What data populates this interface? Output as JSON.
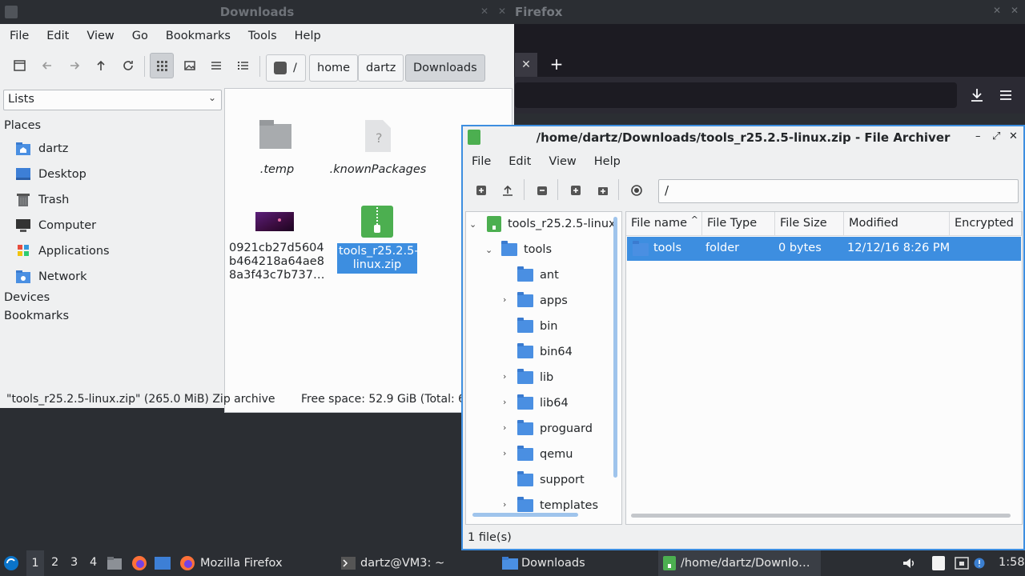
{
  "firefox": {
    "title": "Firefox",
    "close_tab": "✕",
    "new_tab": "+"
  },
  "file_manager": {
    "title": "Downloads",
    "menu": [
      "File",
      "Edit",
      "View",
      "Go",
      "Bookmarks",
      "Tools",
      "Help"
    ],
    "breadcrumbs": {
      "root": "/",
      "home": "home",
      "user": "dartz",
      "current": "Downloads"
    },
    "sidebar": {
      "dropdown": "Lists",
      "places_header": "Places",
      "places": [
        "dartz",
        "Desktop",
        "Trash",
        "Computer",
        "Applications",
        "Network"
      ],
      "devices_header": "Devices",
      "bookmarks_header": "Bookmarks"
    },
    "files": [
      {
        "name": ".temp"
      },
      {
        "name": ".knownPackages"
      },
      {
        "name_lines": [
          "0921cb27d5604",
          "b464218a64ae8",
          "8a3f43c7b737…"
        ]
      },
      {
        "name_lines": [
          "tools_r25.2.5-",
          "linux.zip"
        ]
      }
    ],
    "status_left": "\"tools_r25.2.5-linux.zip\" (265.0 MiB) Zip archive",
    "status_right": "Free space: 52.9 GiB (Total: 62"
  },
  "archiver": {
    "title": "/home/dartz/Downloads/tools_r25.2.5-linux.zip - File Archiver",
    "menu": [
      "File",
      "Edit",
      "View",
      "Help"
    ],
    "path": "/",
    "tree": {
      "root": "tools_r25.2.5-linux",
      "tools": "tools",
      "children": [
        "ant",
        "apps",
        "bin",
        "bin64",
        "lib",
        "lib64",
        "proguard",
        "qemu",
        "support",
        "templates"
      ]
    },
    "columns": [
      "File name",
      "File Type",
      "File Size",
      "Modified",
      "Encrypted"
    ],
    "row": {
      "name": "tools",
      "type": "folder",
      "size": "0 bytes",
      "modified": "12/12/16 8:26 PM"
    },
    "status": "1 file(s)"
  },
  "taskbar": {
    "workspaces": [
      "1",
      "2",
      "3",
      "4"
    ],
    "tasks": [
      "Mozilla Firefox",
      "dartz@VM3: ~",
      "Downloads",
      "/home/dartz/Downlo…"
    ],
    "clock": "1:58"
  }
}
